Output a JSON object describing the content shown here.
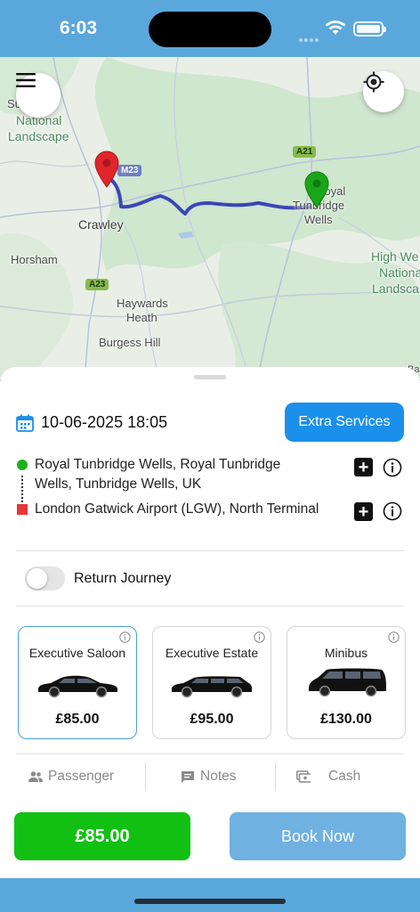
{
  "status_bar": {
    "time": "6:03"
  },
  "map": {
    "labels": {
      "wells_fragment": "Su   Wells",
      "national": "National",
      "landscape": "Landscape",
      "crawley": "Crawley",
      "horsham": "Horsham",
      "haywards_1": "Haywards",
      "haywards_2": "Heath",
      "burgess_hill": "Burgess Hill",
      "tunbridge_1": "Royal",
      "tunbridge_2": "Tunbridge",
      "tunbridge_3": "Wells",
      "high_weald_1": "High We",
      "high_weald_2": "Nationa",
      "high_weald_3": "Landsca",
      "edge_b": "Ba"
    },
    "road_labels": {
      "m23": "M23",
      "a21": "A21",
      "a23": "A23"
    },
    "colors": {
      "route": "#3b47b5",
      "origin_pin": "#19a619",
      "destination_pin": "#e0262b"
    }
  },
  "booking": {
    "datetime": "10-06-2025 18:05",
    "extra_services_label": "Extra Services",
    "pickup": "Royal Tunbridge Wells, Royal Tunbridge Wells, Tunbridge Wells, UK",
    "dropoff": "London Gatwick Airport (LGW), North Terminal",
    "return_journey_label": "Return Journey",
    "return_journey_on": false
  },
  "vehicles": [
    {
      "name": "Executive Saloon",
      "price": "£85.00",
      "selected": true
    },
    {
      "name": "Executive Estate",
      "price": "£95.00",
      "selected": false
    },
    {
      "name": "Minibus",
      "price": "£130.00",
      "selected": false
    }
  ],
  "tabs": {
    "passenger": "Passenger",
    "notes": "Notes",
    "payment": "Cash"
  },
  "footer": {
    "price": "£85.00",
    "book_label": "Book Now"
  },
  "colors": {
    "accent": "#1b90ea",
    "price_green": "#12c014",
    "book_blue": "#6fb1e0",
    "header_blue": "#5aa7dc"
  }
}
